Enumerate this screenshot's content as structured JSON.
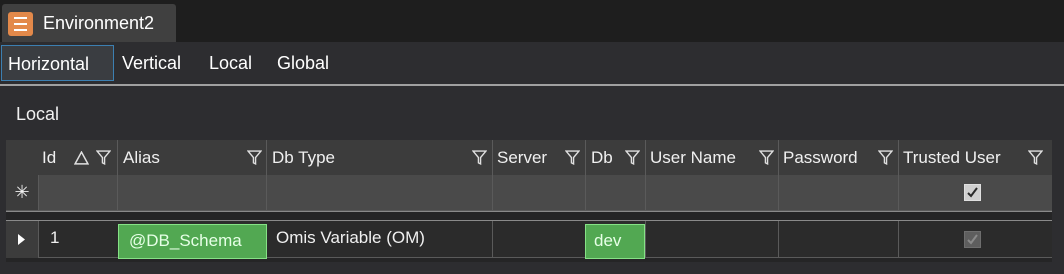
{
  "window": {
    "tab_title": "Environment2",
    "tab_icon": "list-icon"
  },
  "menu": {
    "items": [
      {
        "label": "Horizontal",
        "active": true
      },
      {
        "label": "Vertical",
        "active": false
      },
      {
        "label": "Local",
        "active": false
      },
      {
        "label": "Global",
        "active": false
      }
    ]
  },
  "section": {
    "label": "Local"
  },
  "grid": {
    "columns": [
      "Id",
      "Alias",
      "Db Type",
      "Server",
      "Db",
      "User Name",
      "Password",
      "Trusted User"
    ],
    "new_row_marker": "✳",
    "new_row": {
      "trusted_user": true
    },
    "rows": [
      {
        "id": "1",
        "alias": "@DB_Schema",
        "db_type": "Omis Variable (OM)",
        "server": "",
        "db": "dev",
        "user_name": "",
        "password": "",
        "trusted_user": true
      }
    ]
  },
  "colors": {
    "accent_border": "#3c7fb1",
    "highlight_cell": "#52a852"
  }
}
